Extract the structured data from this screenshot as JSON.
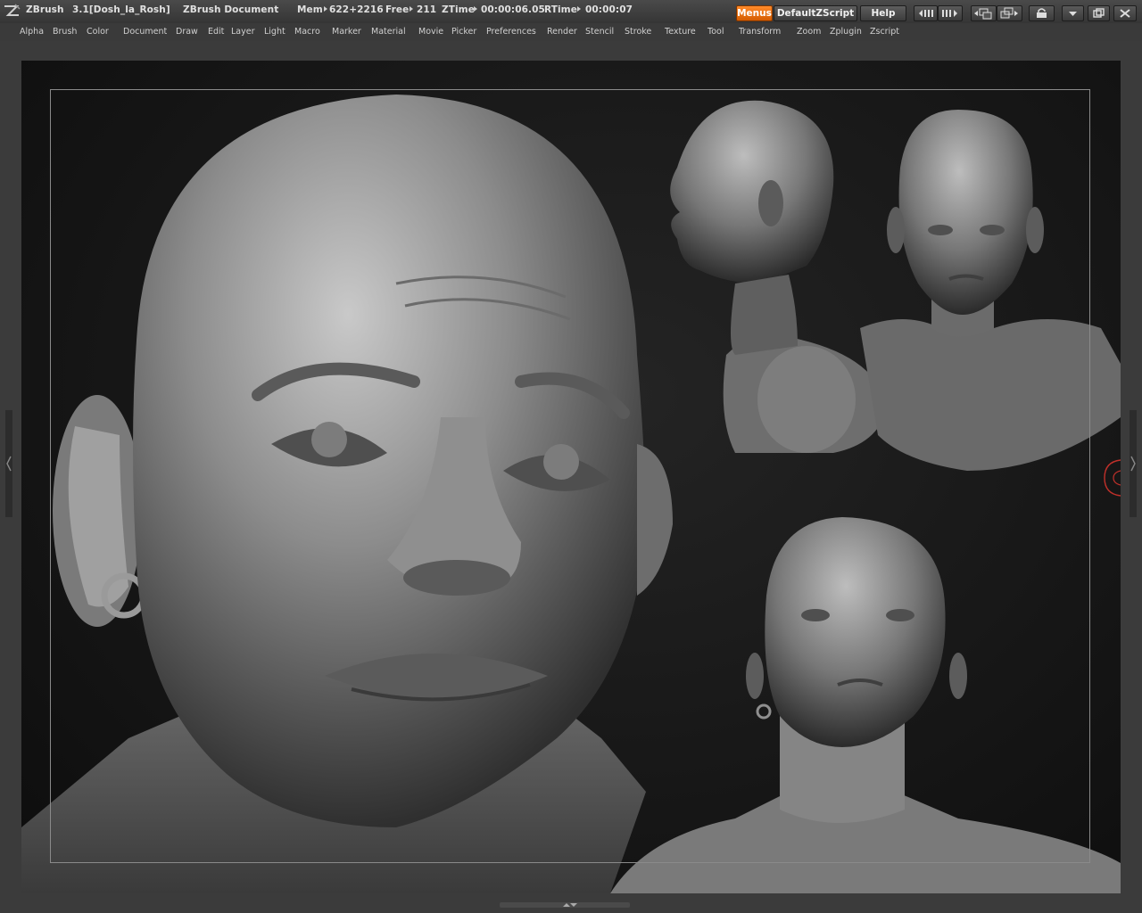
{
  "app": {
    "name": "ZBrush",
    "version_doc": "3.1[Dosh_la_Rosh]",
    "document_label": "ZBrush Document",
    "mem_label": "Mem",
    "mem_value": "622+2216",
    "free_label": "Free",
    "free_value": "211",
    "ztime_label": "ZTime",
    "ztime_value": "00:00:06.05",
    "rtime_label": "RTime",
    "rtime_value": "00:00:07"
  },
  "toolbar": {
    "menus_label": "Menus",
    "script_label": "DefaultZScript",
    "help_label": "Help"
  },
  "menu": {
    "items": [
      "Alpha",
      "Brush",
      "Color",
      "Document",
      "Draw",
      "Edit",
      "Layer",
      "Light",
      "Macro",
      "Marker",
      "Material",
      "Movie",
      "Picker",
      "Preferences",
      "Render",
      "Stencil",
      "Stroke",
      "Texture",
      "Tool",
      "Transform",
      "Zoom",
      "Zplugin",
      "Zscript"
    ]
  },
  "icons": {
    "logo": "zbrush-logo-icon",
    "scroll_left": "scroll-left-icon",
    "scroll_right": "scroll-right-icon",
    "layout_1": "layout-icon",
    "layout_2": "layout-alt-icon",
    "lock": "lock-icon",
    "minimize": "minimize-icon",
    "restore": "restore-icon",
    "close": "close-icon"
  },
  "colors": {
    "accent": "#e8720c",
    "canvas_bg": "#161616",
    "ui_bg": "#3b3b3b"
  }
}
